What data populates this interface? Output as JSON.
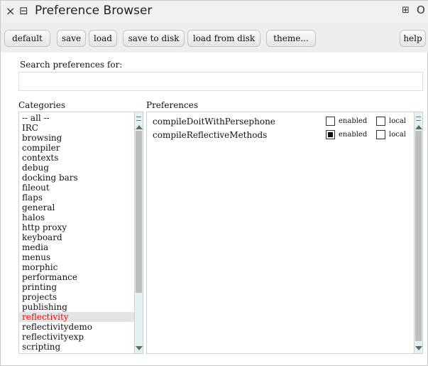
{
  "window": {
    "title": "Preference Browser",
    "close_glyph": "×",
    "menu_glyph": "⊟",
    "collapse_glyph": "⊞",
    "expand_glyph": "O"
  },
  "toolbar": {
    "buttons": [
      "default",
      "save",
      "load",
      "save to disk",
      "load from disk",
      "theme...",
      "help"
    ]
  },
  "search": {
    "label": "Search preferences for:",
    "value": ""
  },
  "categories": {
    "label": "Categories",
    "items": [
      "-- all --",
      "IRC",
      "browsing",
      "compiler",
      "contexts",
      "debug",
      "docking bars",
      "fileout",
      "flaps",
      "general",
      "halos",
      "http proxy",
      "keyboard",
      "media",
      "menus",
      "morphic",
      "performance",
      "printing",
      "projects",
      "publishing",
      "reflectivity",
      "reflectivitydemo",
      "reflectivityexp",
      "scripting"
    ],
    "selected": "reflectivity",
    "selected_color": "#ff0000"
  },
  "preferences": {
    "label": "Preferences",
    "enabled_label": "enabled",
    "local_label": "local",
    "items": [
      {
        "name": "compileDoitWithPersephone",
        "enabled": false,
        "local": false
      },
      {
        "name": "compileReflectiveMethods",
        "enabled": true,
        "local": false
      }
    ]
  }
}
